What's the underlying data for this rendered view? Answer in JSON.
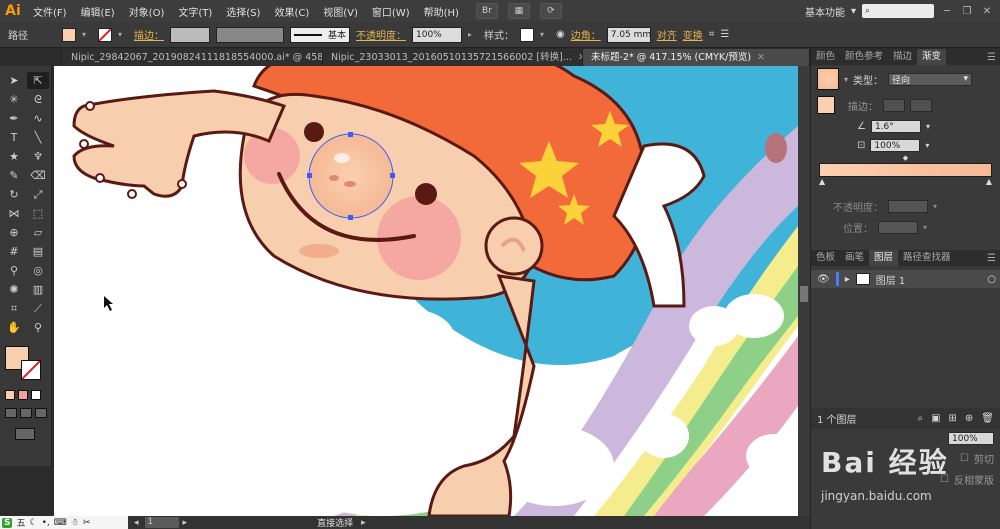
{
  "app": {
    "logo": "Ai"
  },
  "menu": [
    "文件(F)",
    "编辑(E)",
    "对象(O)",
    "文字(T)",
    "选择(S)",
    "效果(C)",
    "视图(V)",
    "窗口(W)",
    "帮助(H)"
  ],
  "menu_icons": [
    "Br",
    "St"
  ],
  "workspace": {
    "label": "基本功能",
    "search_placeholder": ""
  },
  "control": {
    "object_type": "路径",
    "stroke_label": "描边：",
    "stroke_style": "基本",
    "opacity_label": "不透明度：",
    "opacity_value": "100%",
    "style_label": "样式：",
    "corner_label": "边角：",
    "corner_value": "7.05 mm",
    "align_label": "对齐",
    "transform_label": "变换"
  },
  "tabs": [
    {
      "label": "Nipic_29842067_20190824111818554000.ai* @ 458...",
      "active": false
    },
    {
      "label": "Nipic_23033013_20160510135721566002 [转换]...",
      "active": false
    },
    {
      "label": "未标题-2* @ 417.15% (CMYK/预览)",
      "active": true
    }
  ],
  "statusbar": {
    "page": "1",
    "tool_name": "直接选择"
  },
  "ime": {
    "logo": "S",
    "mode": "五"
  },
  "gradient_panel": {
    "tabs": [
      "颜色",
      "颜色参考",
      "描边",
      "渐变"
    ],
    "type_label": "类型：",
    "type_value": "径向",
    "stroke_label": "描边：",
    "angle_value": "1.6°",
    "ratio_value": "100%",
    "opacity_label": "不透明度：",
    "position_label": "位置："
  },
  "layers_panel": {
    "tabs": [
      "色板",
      "画笔",
      "图层",
      "路径查找器"
    ],
    "layer_name": "图层 1",
    "layer_count": "1 个图层"
  },
  "transparency_panel": {
    "opacity_value": "100%",
    "clip_label": "剪切",
    "invert_label": "反相蒙版"
  },
  "watermark": {
    "text": "Bai 经验",
    "sub": "jingyan.baidu.com"
  },
  "colors": {
    "skin": "#f8cfae",
    "hair": "#f26a3a",
    "outline": "#5a1a14",
    "cheek": "#f4a0a0",
    "star": "#fcd23a",
    "sky": "#3fb3d8",
    "rainbow": [
      "#cbb8dc",
      "#e9a7c0",
      "#f5ec8e",
      "#8fd089",
      "#c8b6de"
    ]
  }
}
